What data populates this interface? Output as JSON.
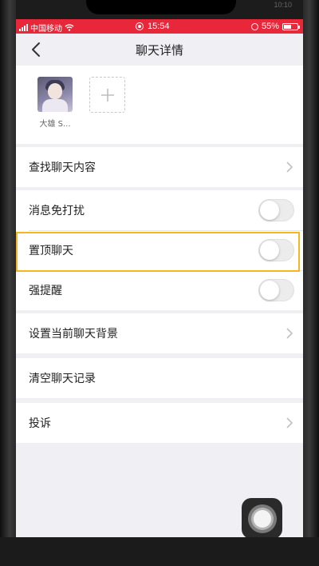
{
  "status_bar": {
    "carrier": "中国移动",
    "time": "15:54",
    "battery": "55%",
    "battery_level": 0.55
  },
  "frame": {
    "top_right_time": "10:10"
  },
  "navbar": {
    "title": "聊天详情",
    "back_icon": "chevron-left-icon"
  },
  "members": [
    {
      "name": "大雄 S...",
      "avatar": "anime-avatar"
    }
  ],
  "add_member_icon": "plus-icon",
  "settings": {
    "search_chat": "查找聊天内容",
    "mute": {
      "label": "消息免打扰",
      "on": false
    },
    "pin": {
      "label": "置顶聊天",
      "on": false
    },
    "alert": {
      "label": "强提醒",
      "on": false
    },
    "background": "设置当前聊天背景",
    "clear": "清空聊天记录",
    "report": "投诉"
  },
  "highlight_color": "#f5b622",
  "accent_color": "#e8283a"
}
